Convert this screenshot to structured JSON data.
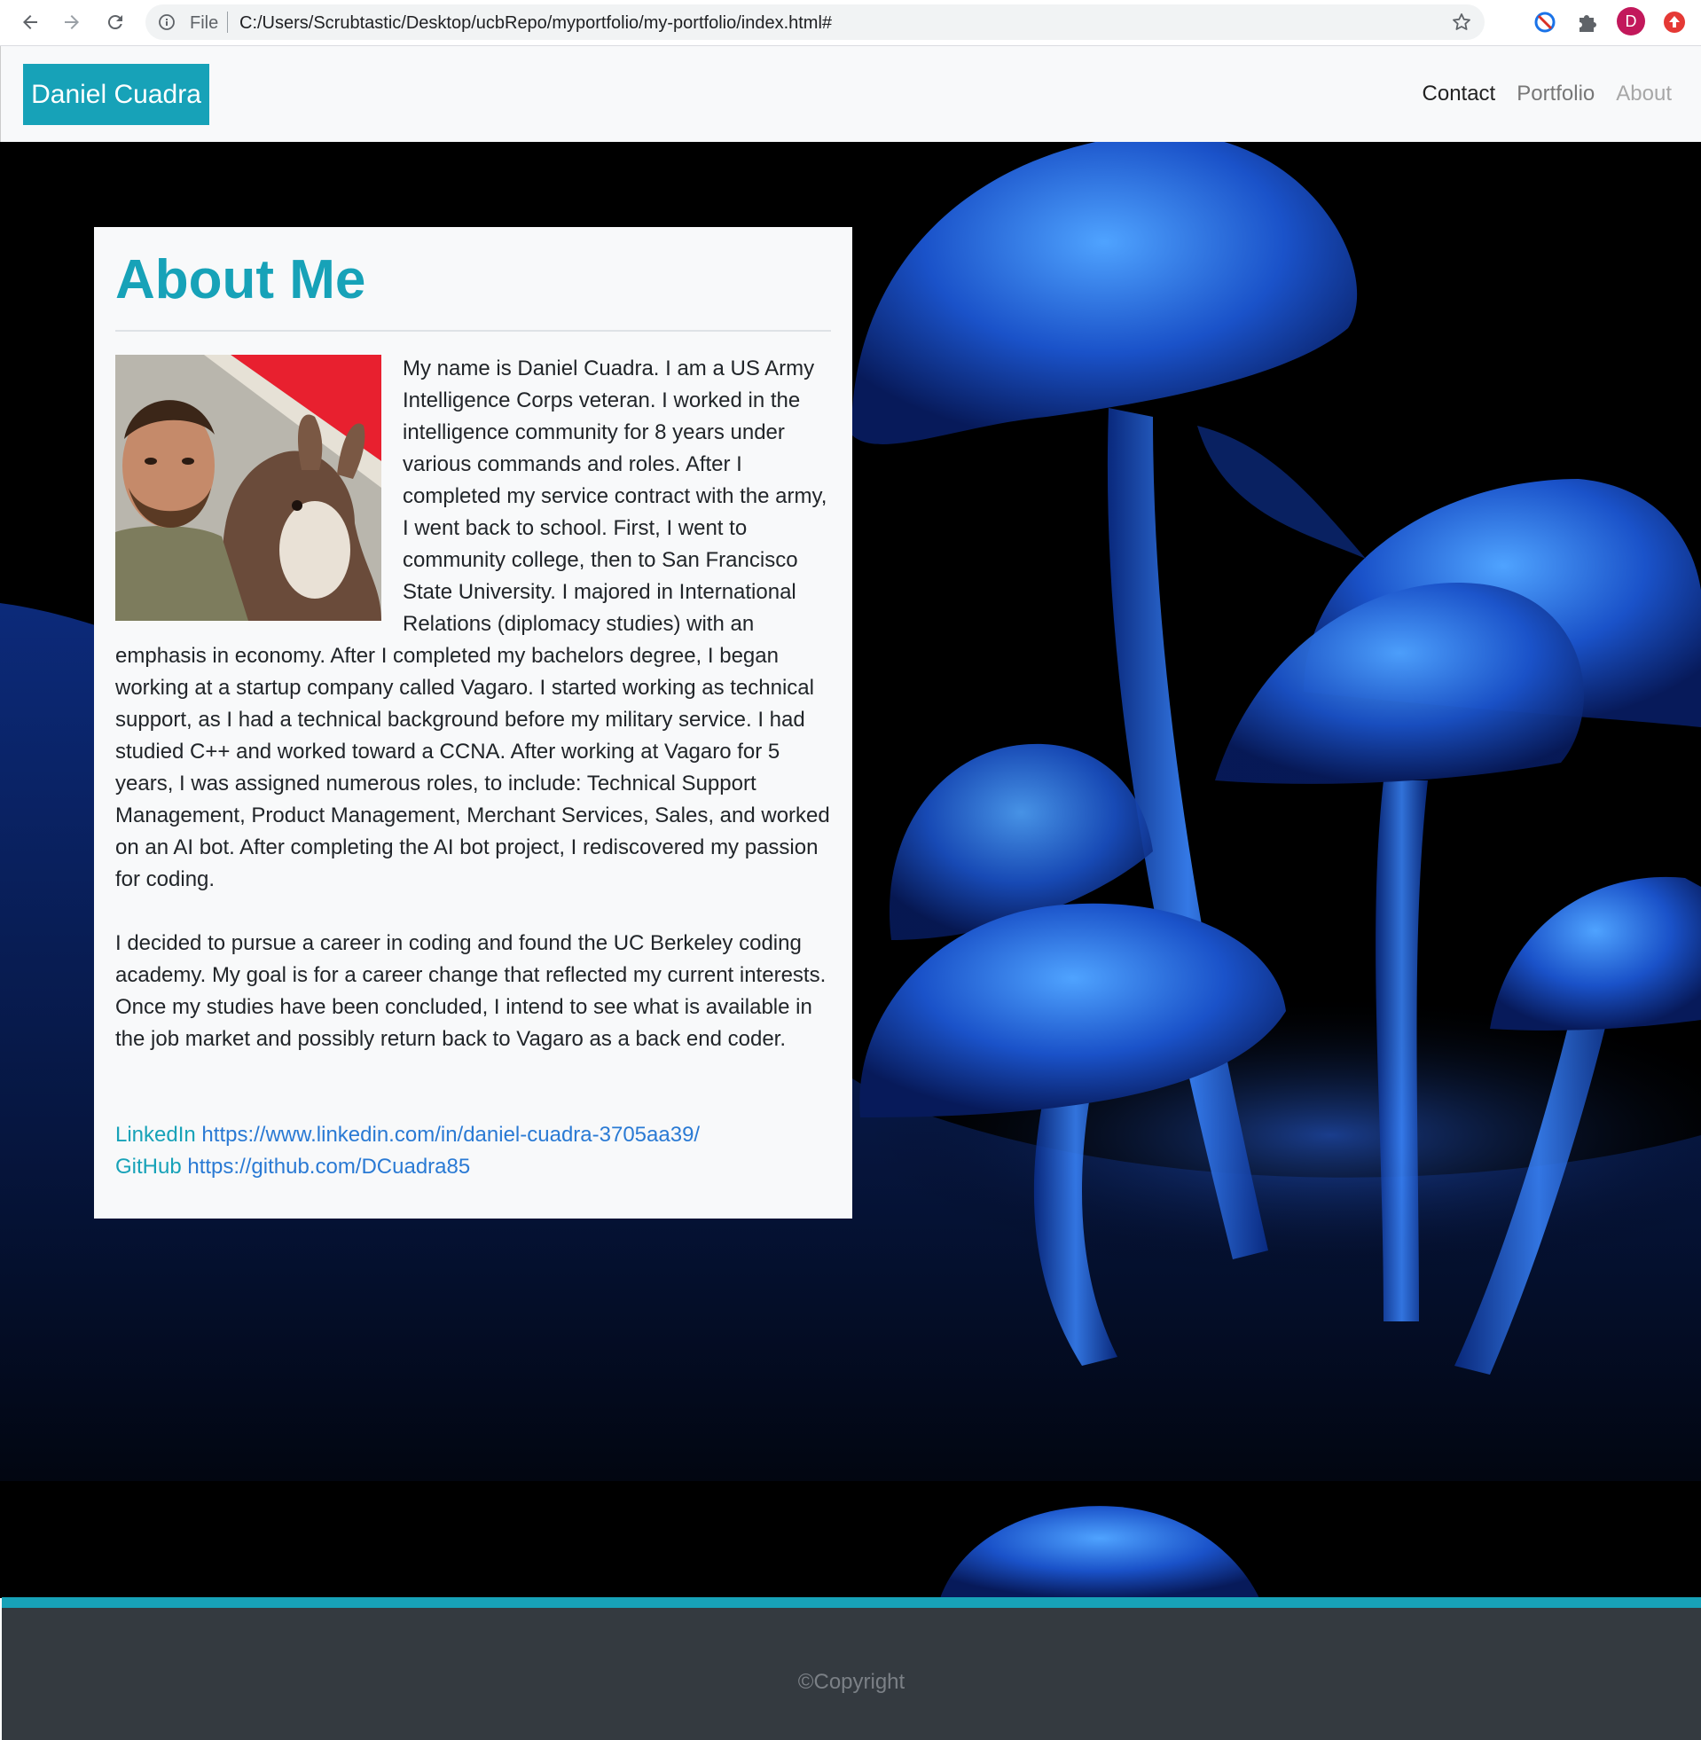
{
  "browser": {
    "file_label": "File",
    "url": "C:/Users/Scrubtastic/Desktop/ucbRepo/myportfolio/my-portfolio/index.html#",
    "profile_initial": "D"
  },
  "navbar": {
    "brand": "Daniel Cuadra",
    "links": [
      {
        "label": "Contact"
      },
      {
        "label": "Portfolio"
      },
      {
        "label": "About"
      }
    ]
  },
  "about": {
    "heading": "About Me",
    "paragraph1": "My name is Daniel Cuadra. I am a US Army Intelligence Corps veteran. I worked in the intelligence community for 8 years under various commands and roles. After I completed my service contract with the army, I went back to school. First, I went to community college, then to San Francisco State University. I majored in International Relations (diplomacy studies) with an emphasis in economy. After I completed my bachelors degree, I began working at a startup company called Vagaro. I started working as technical support, as I had a technical background before my military service. I had studied C++ and worked toward a CCNA. After working at Vagaro for 5 years, I was assigned numerous roles, to include: Technical Support Management, Product Management, Merchant Services, Sales, and worked on an AI bot. After completing the AI bot project, I rediscovered my passion for coding.",
    "paragraph2": "I decided to pursue a career in coding and found the UC Berkeley coding academy. My goal is for a career change that reflected my current interests. Once my studies have been concluded, I intend to see what is available in the job market and possibly return back to Vagaro as a back end coder.",
    "linkedin_label": "LinkedIn",
    "linkedin_url": "https://www.linkedin.com/in/daniel-cuadra-3705aa39/",
    "github_label": "GitHub",
    "github_url": "https://github.com/DCuadra85"
  },
  "footer": {
    "copyright": "©Copyright"
  },
  "colors": {
    "accent": "#17a2b8",
    "footer_bg": "#343a40",
    "card_bg": "#f8f9fa"
  }
}
